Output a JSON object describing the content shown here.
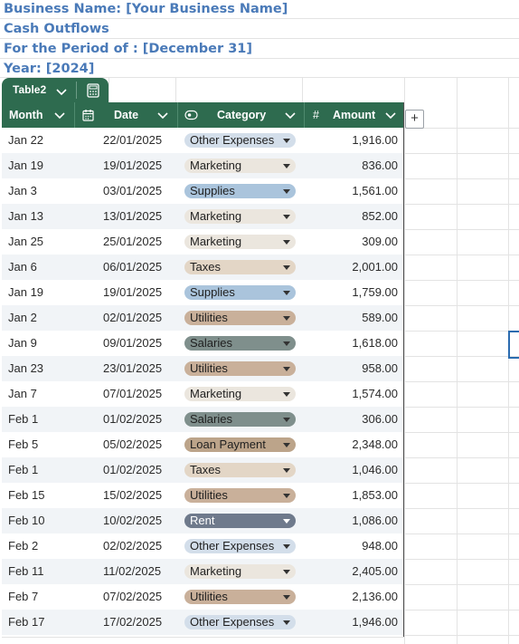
{
  "header": {
    "business_name": "Business Name: [Your Business Name]",
    "subtitle": "Cash Outflows",
    "period": "For the Period of : [December 31]",
    "year": "Year: [2024]"
  },
  "table_tab": {
    "name": "Table2",
    "chevron_icon": "chevron-down-icon",
    "calc_icon": "calculator-icon"
  },
  "columns": [
    {
      "label": "Month",
      "icon": ""
    },
    {
      "label": "Date",
      "icon": "calendar-icon"
    },
    {
      "label": "Category",
      "icon": "choice-icon"
    },
    {
      "label": "Amount",
      "icon": "hash-icon"
    }
  ],
  "add_column_label": "+",
  "category_colors": {
    "Other Expenses": "#d3deea",
    "Marketing": "#ebe6de",
    "Supplies": "#aac4dc",
    "Taxes": "#e3d6c6",
    "Utilities": "#c9b09a",
    "Salaries": "#7f8f8c",
    "Loan Payment": "#bca48a",
    "Rent": "#6f7a8c"
  },
  "rows": [
    {
      "month": "Jan 22",
      "date": "22/01/2025",
      "category": "Other Expenses",
      "amount": "1,916.00"
    },
    {
      "month": "Jan 19",
      "date": "19/01/2025",
      "category": "Marketing",
      "amount": "836.00"
    },
    {
      "month": "Jan 3",
      "date": "03/01/2025",
      "category": "Supplies",
      "amount": "1,561.00"
    },
    {
      "month": "Jan 13",
      "date": "13/01/2025",
      "category": "Marketing",
      "amount": "852.00"
    },
    {
      "month": "Jan 25",
      "date": "25/01/2025",
      "category": "Marketing",
      "amount": "309.00"
    },
    {
      "month": "Jan 6",
      "date": "06/01/2025",
      "category": "Taxes",
      "amount": "2,001.00"
    },
    {
      "month": "Jan 19",
      "date": "19/01/2025",
      "category": "Supplies",
      "amount": "1,759.00"
    },
    {
      "month": "Jan 2",
      "date": "02/01/2025",
      "category": "Utilities",
      "amount": "589.00"
    },
    {
      "month": "Jan 9",
      "date": "09/01/2025",
      "category": "Salaries",
      "amount": "1,618.00"
    },
    {
      "month": "Jan 23",
      "date": "23/01/2025",
      "category": "Utilities",
      "amount": "958.00"
    },
    {
      "month": "Jan 7",
      "date": "07/01/2025",
      "category": "Marketing",
      "amount": "1,574.00"
    },
    {
      "month": "Feb 1",
      "date": "01/02/2025",
      "category": "Salaries",
      "amount": "306.00"
    },
    {
      "month": "Feb 5",
      "date": "05/02/2025",
      "category": "Loan Payment",
      "amount": "2,348.00"
    },
    {
      "month": "Feb 1",
      "date": "01/02/2025",
      "category": "Taxes",
      "amount": "1,046.00"
    },
    {
      "month": "Feb 15",
      "date": "15/02/2025",
      "category": "Utilities",
      "amount": "1,853.00"
    },
    {
      "month": "Feb 10",
      "date": "10/02/2025",
      "category": "Rent",
      "amount": "1,086.00"
    },
    {
      "month": "Feb 2",
      "date": "02/02/2025",
      "category": "Other Expenses",
      "amount": "948.00"
    },
    {
      "month": "Feb 11",
      "date": "11/02/2025",
      "category": "Marketing",
      "amount": "2,405.00"
    },
    {
      "month": "Feb 7",
      "date": "07/02/2025",
      "category": "Utilities",
      "amount": "2,136.00"
    },
    {
      "month": "Feb 17",
      "date": "17/02/2025",
      "category": "Other Expenses",
      "amount": "1,946.00"
    }
  ]
}
